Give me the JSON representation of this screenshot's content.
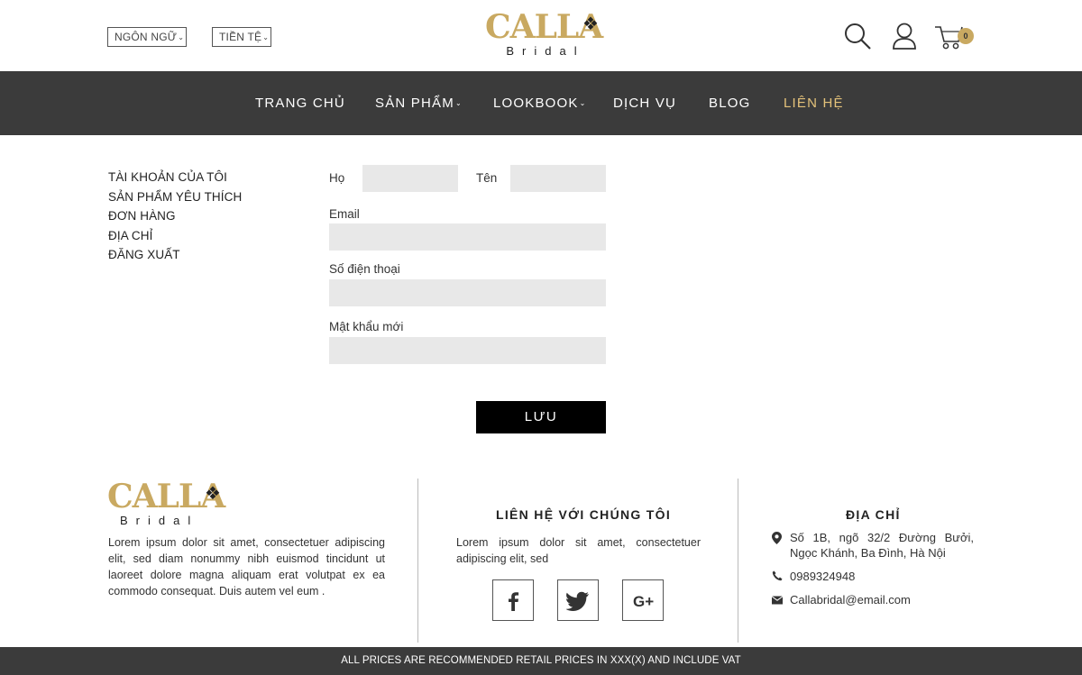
{
  "header": {
    "language_label": "NGÔN NGỮ",
    "currency_label": "TIỀN TỆ",
    "logo_word": "CALLA",
    "logo_sub": "Bridal",
    "cart_count": "0",
    "icons": [
      "search-icon",
      "user-icon",
      "cart-icon"
    ]
  },
  "nav": {
    "items": [
      {
        "label": "TRANG CHỦ"
      },
      {
        "label": "SẢN PHẨM"
      },
      {
        "label": "LOOKBOOK"
      },
      {
        "label": "DỊCH VỤ"
      },
      {
        "label": "BLOG"
      },
      {
        "label": "LIÊN HỆ"
      }
    ]
  },
  "account_menu": {
    "items": [
      "TÀI KHOẢN CỦA TÔI",
      "SẢN PHẨM YÊU THÍCH",
      "ĐƠN HÀNG",
      "ĐỊA CHỈ",
      "ĐĂNG XUẤT"
    ]
  },
  "form": {
    "last_name_label": "Họ",
    "first_name_label": "Tên",
    "email_label": "Email",
    "phone_label": "Số điện thoại",
    "password_label": "Mật khẩu mới",
    "last_name_value": "",
    "first_name_value": "",
    "email_value": "",
    "phone_value": "",
    "password_value": "",
    "save_label": "LƯU"
  },
  "footer": {
    "logo_word": "CALLA",
    "logo_sub": "Bridal",
    "about_text": "Lorem ipsum dolor sit amet, consectetuer adipiscing elit, sed diam nonummy nibh euismod tincidunt ut laoreet dolore magna aliquam erat volutpat ex ea commodo consequat. Duis autem vel eum .",
    "contact_heading": "LIÊN HỆ VỚI CHÚNG TÔI",
    "contact_text": "Lorem ipsum dolor sit amet, consectetuer adipiscing elit, sed",
    "social_icons": [
      "facebook-icon",
      "twitter-icon",
      "google-plus-icon"
    ],
    "address_heading": "ĐỊA CHỈ",
    "address": "Số 1B, ngõ 32/2 Đường Bưởi, Ngọc Khánh, Ba Đình, Hà Nội",
    "phone": "0989324948",
    "email": "Callabridal@email.com",
    "bottom_notice": "ALL PRICES ARE RECOMMENDED RETAIL PRICES IN XXX(X) AND INCLUDE VAT"
  },
  "colors": {
    "accent_gold": "#c9a961",
    "nav_active": "#e4c27a",
    "nav_background": "#3b3b3b",
    "field_background": "#e8e8e8",
    "button_background": "#000000"
  }
}
